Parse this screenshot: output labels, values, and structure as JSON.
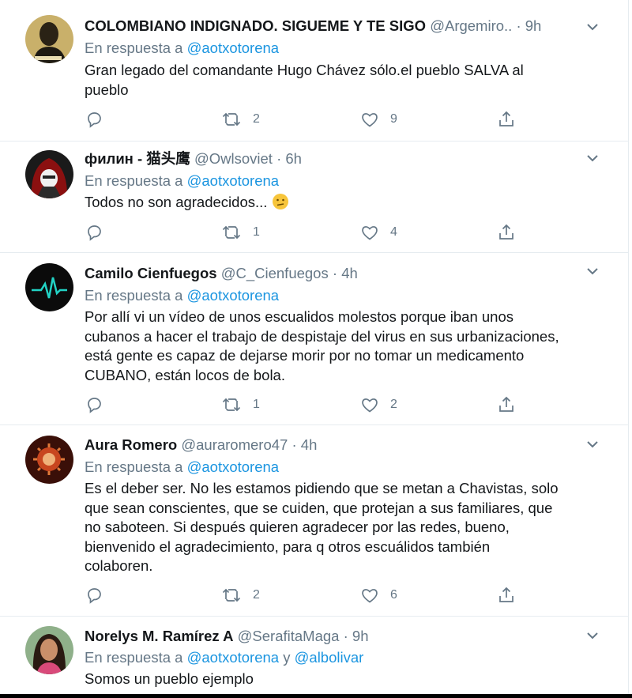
{
  "tweets": [
    {
      "name": "COLOMBIANO INDIGNADO. SIGUEME Y TE SIGO",
      "handle": "@Argemiro..",
      "dot": "·",
      "time": "9h",
      "reply_prefix": "En respuesta a",
      "mention": "@aotxotorena",
      "text_lines": [
        "Gran legado del comandante Hugo Chávez sólo.el pueblo SALVA al",
        "pueblo"
      ],
      "retweets": "2",
      "likes": "9",
      "avatar_icon": "portrait-avatar"
    },
    {
      "name": "филин - 猫头鹰",
      "handle": "@Owlsoviet",
      "dot": "·",
      "time": "6h",
      "reply_prefix": "En respuesta a",
      "mention": "@aotxotorena",
      "text_lines": [
        "Todos no son agradecidos..."
      ],
      "emoji": "confused-face-emoji",
      "retweets": "1",
      "likes": "4",
      "avatar_icon": "masked-figure-avatar"
    },
    {
      "name": "Camilo Cienfuegos",
      "handle": "@C_Cienfuegos",
      "dot": "·",
      "time": "4h",
      "reply_prefix": "En respuesta a",
      "mention": "@aotxotorena",
      "text_lines": [
        "Por allí vi un vídeo de unos escualidos molestos porque iban unos",
        "cubanos a hacer el trabajo de despistaje del virus en sus urbanizaciones,",
        "está gente es capaz de dejarse morir por no tomar un medicamento",
        "CUBANO, están locos de bola."
      ],
      "retweets": "1",
      "likes": "2",
      "avatar_icon": "heartbeat-avatar"
    },
    {
      "name": "Aura Romero",
      "handle": "@auraromero47",
      "dot": "·",
      "time": "4h",
      "reply_prefix": "En respuesta a",
      "mention": "@aotxotorena",
      "text_lines": [
        "Es el deber ser. No les estamos pidiendo que se metan a Chavistas, solo",
        "que sean conscientes, que se cuiden, que protejan a sus familiares, que",
        "no saboteen. Si después quieren agradecer por las redes, bueno,",
        "bienvenido el agradecimiento, para q otros escuálidos también",
        "colaboren."
      ],
      "retweets": "2",
      "likes": "6",
      "avatar_icon": "virus-avatar"
    },
    {
      "name": "Norelys M. Ramírez A",
      "handle": "@SerafitaMaga",
      "dot": "·",
      "time": "9h",
      "reply_prefix": "En respuesta a",
      "mention": "@aotxotorena",
      "connector": "y",
      "mention2": "@albolivar",
      "text_lines": [
        "Somos un pueblo ejemplo"
      ],
      "avatar_icon": "woman-photo-avatar"
    }
  ],
  "colors": {
    "link": "#1b95e0",
    "secondary": "#657786",
    "primary_text": "#14171a",
    "divider": "#e6ecf0"
  }
}
